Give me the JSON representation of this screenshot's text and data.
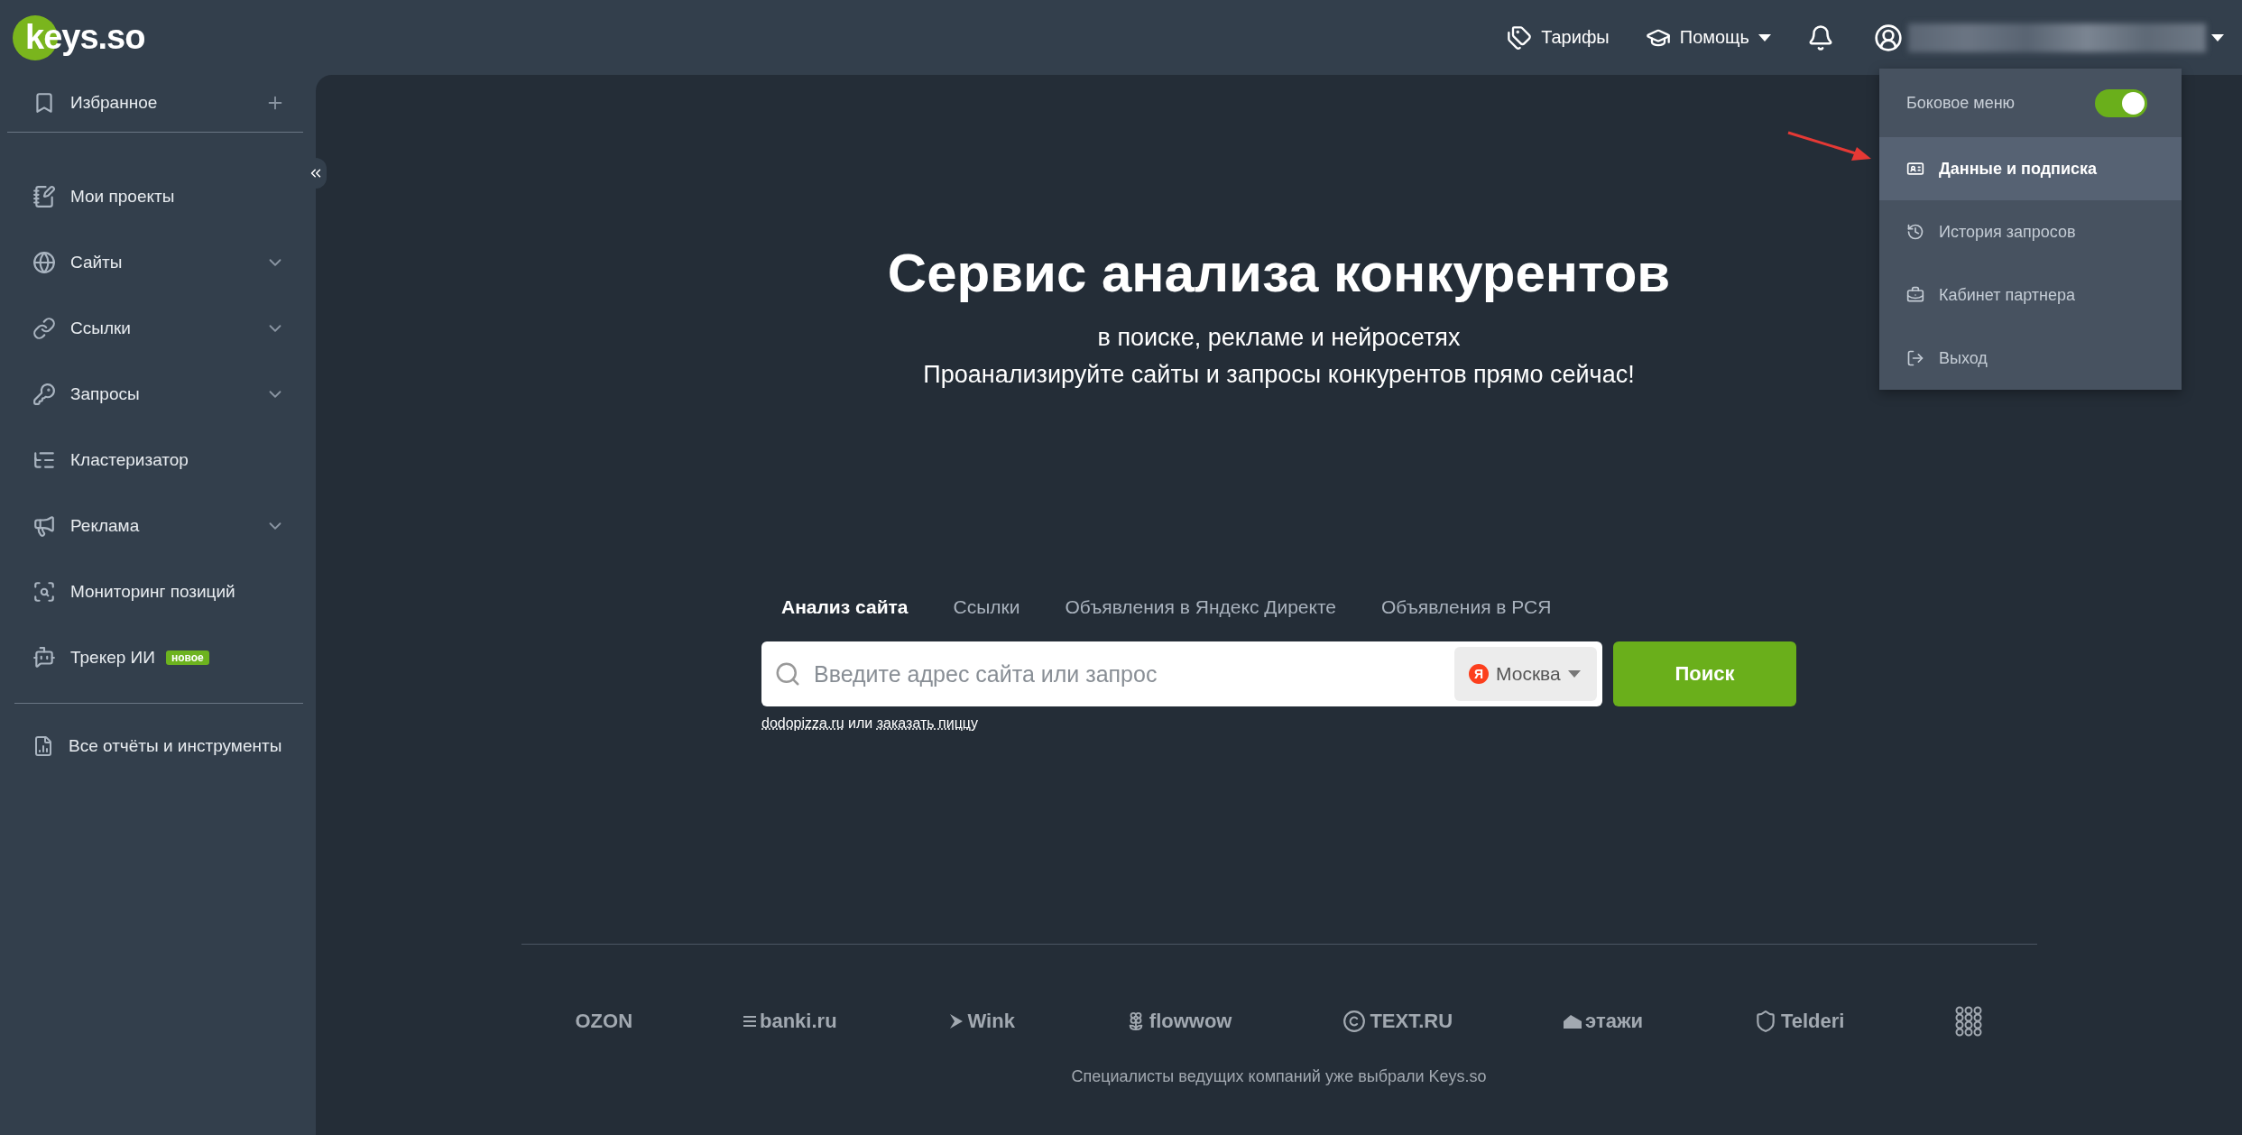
{
  "header": {
    "logo": "keys.so",
    "nav": [
      {
        "label": "Тарифы",
        "dropdown": false
      },
      {
        "label": "Помощь",
        "dropdown": true
      }
    ]
  },
  "sidebar": {
    "favorites": {
      "label": "Избранное"
    },
    "items": [
      {
        "label": "Мои проекты",
        "expandable": false
      },
      {
        "label": "Сайты",
        "expandable": true
      },
      {
        "label": "Ссылки",
        "expandable": true
      },
      {
        "label": "Запросы",
        "expandable": true
      },
      {
        "label": "Кластеризатор",
        "expandable": false
      },
      {
        "label": "Реклама",
        "expandable": true
      },
      {
        "label": "Мониторинг позиций",
        "expandable": false
      },
      {
        "label": "Трекер ИИ",
        "expandable": false,
        "badge": "новое"
      }
    ],
    "footer_item": {
      "label": "Все отчёты и инструменты"
    }
  },
  "user_menu": {
    "toggle": {
      "label": "Боковое меню",
      "on": true
    },
    "items": [
      {
        "label": "Данные и подписка",
        "selected": true
      },
      {
        "label": "История запросов",
        "selected": false
      },
      {
        "label": "Кабинет партнера",
        "selected": false
      },
      {
        "label": "Выход",
        "selected": false
      }
    ]
  },
  "hero": {
    "title": "Сервис анализа конкурентов",
    "subtitle": "в поиске, рекламе и нейросетях",
    "tagline": "Проанализируйте сайты и запросы конкурентов прямо сейчас!"
  },
  "search": {
    "tabs": [
      {
        "label": "Анализ сайта",
        "selected": true
      },
      {
        "label": "Ссылки",
        "selected": false
      },
      {
        "label": "Объявления в Яндекс Директе",
        "selected": false
      },
      {
        "label": "Объявления в РСЯ",
        "selected": false
      }
    ],
    "placeholder": "Введите адрес сайта или запрос",
    "region": "Москва",
    "region_mark": "Я",
    "button": "Поиск",
    "examples": {
      "first": "dodopizza.ru",
      "joiner": "или",
      "second": "заказать пиццу"
    }
  },
  "clients": {
    "logos": [
      {
        "label": "OZON",
        "kind": "plain"
      },
      {
        "label": "banki.ru",
        "kind": "banki"
      },
      {
        "label": "Wink",
        "kind": "wink"
      },
      {
        "label": "flowwow",
        "kind": "flower"
      },
      {
        "label": "TEXT.RU",
        "kind": "copyright"
      },
      {
        "label": "этажи",
        "kind": "house"
      },
      {
        "label": "Telderi",
        "kind": "shield"
      },
      {
        "kind": "grid"
      }
    ],
    "caption": "Специалисты ведущих компаний уже выбрали Keys.so"
  }
}
